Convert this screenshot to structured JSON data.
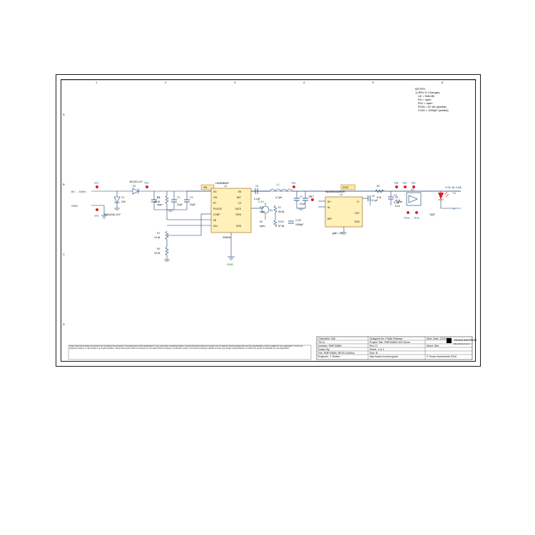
{
  "domain": "Diagram",
  "sheet": {
    "notes_header": "NOTES:",
    "rev_header": "1) REV D Changes:",
    "notes": [
      "U2 = INA180",
      "R4 = open",
      "R11 = open",
      "R100 = 87.6K (added)",
      "C100 = 1000pF (added)"
    ],
    "grid_cols": [
      "1",
      "2",
      "3",
      "4",
      "5",
      "6"
    ],
    "grid_rows": [
      "A",
      "B",
      "C",
      "D"
    ]
  },
  "io": {
    "vin_label": "8V ... 18Vin",
    "gnd_label": "GND",
    "vout_label": "2.5V @ 3.5A",
    "out_pins": [
      "+V",
      "-V"
    ]
  },
  "nets": {
    "vin": "VIN",
    "vout": "VOUT"
  },
  "components": {
    "D1": {
      "ref": "D1",
      "part": "SMAJ24A-13-F",
      "value": "24V"
    },
    "D2": {
      "ref": "D2",
      "part": "B2100-13-F"
    },
    "U1": {
      "ref": "U1",
      "part": "LM25085MY",
      "pins": [
        "EN",
        "VIN",
        "SN",
        "BST",
        "CS",
        "GATE",
        "ISEN",
        "FB",
        "COMP",
        "GND",
        "ADJ"
      ],
      "fsw": "320kHz"
    },
    "U2": {
      "ref": "U2",
      "part": "INA180A2QDBVR",
      "gain": "gain = 20",
      "pins": [
        "IN+",
        "IN-",
        "V+",
        "OUT",
        "GND",
        "REF"
      ]
    },
    "U3": {
      "ref": "U3",
      "part": "",
      "role": "opamp"
    },
    "L1": {
      "ref": "L1",
      "value": "4.7µH"
    },
    "Q1": {
      "ref": "Q1",
      "part": "BSS138"
    },
    "C2": {
      "ref": "C2",
      "value": "22µF"
    },
    "C3": {
      "ref": "C3",
      "value": "22µF"
    },
    "C4": {
      "ref": "C4",
      "value": "open"
    },
    "C5": {
      "ref": "C5",
      "value": "0.1µF"
    },
    "C6": {
      "ref": "C6",
      "value": "0.1µF"
    },
    "C7": {
      "ref": "C7",
      "value": "47µF"
    },
    "C8": {
      "ref": "C8",
      "value": "47µF"
    },
    "C9": {
      "ref": "C9",
      "value": "0.1µF"
    },
    "C100": {
      "ref": "C100",
      "value": "1000pF"
    },
    "R1": {
      "ref": "R1",
      "value": "12.4k"
    },
    "R3": {
      "ref": "R3",
      "value": "40.2k"
    },
    "R4": {
      "ref": "R4",
      "value": "open"
    },
    "R5": {
      "ref": "R5",
      "value": "10.2k"
    },
    "R6": {
      "ref": "R6",
      "value": ""
    },
    "R7": {
      "ref": "R7",
      "value": "45.3k"
    },
    "R8": {
      "ref": "R8",
      "value": "0.01"
    },
    "R9": {
      "ref": "R9",
      "value": "5.1k"
    },
    "R11": {
      "ref": "R11",
      "value": "open"
    },
    "R100": {
      "ref": "R100",
      "value": "87.6k"
    },
    "V1": {
      "label": "2.5V"
    }
  },
  "testpoints": [
    "TP1",
    "TP2",
    "TP3",
    "TP4",
    "TP5",
    "TP6",
    "TP7",
    "TP8",
    "TP9",
    "TP10",
    "TP11",
    "TP12"
  ],
  "titleblock": {
    "rows": [
      [
        "Orderable: N/A",
        "Designed for: Public Release",
        "Mod. Date: 2/20/2018"
      ],
      [
        "TID #:",
        "Project Title: PMP20859 LED Driver",
        ""
      ],
      [
        "Number: PMP20859",
        "Rev: D",
        "Sheet Title:"
      ],
      [
        "Drawn By:",
        "Sheet: 1 of 1",
        ""
      ],
      [
        "File: PMP20859_REVD.SchDoc",
        "Size: B",
        ""
      ],
      [
        "Engineer: J. Betten",
        "http://www.ti.com/support",
        "© Texas Instruments 2018"
      ]
    ],
    "company": "TEXAS INSTRUMENTS",
    "url": "http://www.ti.com"
  },
  "disclaimer": "Texas Instruments and/or its licensors do not warrant the accuracy or completeness of this specification or any information contained therein. Texas Instruments and/or its licensors do not warrant that this design will meet the specifications, will be suitable for your application or fit for any particular purpose, or will operate in an implementation. Texas Instruments and/or its licensors do not warrant that the design is production worthy. You should completely validate and test your design implementation to confirm the system functionality for your application."
}
